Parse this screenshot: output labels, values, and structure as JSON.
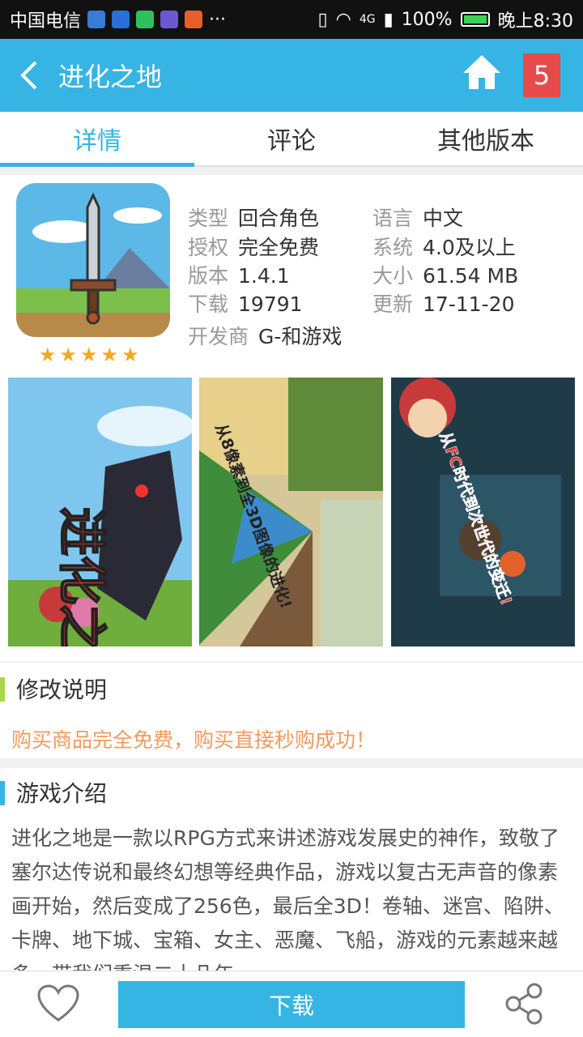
{
  "status_bar": {
    "carrier": "中国电信",
    "network": "4G",
    "battery": "100%",
    "time": "晚上8:30"
  },
  "header": {
    "title": "进化之地",
    "badge_count": "5"
  },
  "tabs": [
    "详情",
    "评论",
    "其他版本"
  ],
  "app_info": {
    "rating_stars": 5,
    "fields": [
      {
        "label": "类型",
        "value": "回合角色"
      },
      {
        "label": "语言",
        "value": "中文"
      },
      {
        "label": "授权",
        "value": "完全免费"
      },
      {
        "label": "系统",
        "value": "4.0及以上"
      },
      {
        "label": "版本",
        "value": "1.4.1"
      },
      {
        "label": "大小",
        "value": "61.54 MB"
      },
      {
        "label": "下载",
        "value": "19791"
      },
      {
        "label": "更新",
        "value": "17-11-20"
      },
      {
        "label": "开发商",
        "value": "G-和游戏"
      }
    ]
  },
  "screenshots": {
    "shot1_title": "进化之地",
    "shot2_caption": "从8像素到全3D图像的进化!",
    "shot3_caption": "从FC时代到次世代的变迁!"
  },
  "modification": {
    "title": "修改说明",
    "text": "购买商品完全免费，购买直接秒购成功！"
  },
  "intro": {
    "title": "游戏介绍",
    "text": "进化之地是一款以RPG方式来讲述游戏发展史的神作，致敬了塞尔达传说和最终幻想等经典作品，游戏以复古无声音的像素画开始，然后变成了256色，最后全3D！卷轴、迷宫、陷阱、卡牌、地下城、宝箱、女主、恶魔、飞船，游戏的元素越来越多，带我们重温二十几年"
  },
  "bottom": {
    "download_label": "下载"
  },
  "colors": {
    "primary": "#36b4e4",
    "badge": "#e74a4a",
    "accent_orange": "#f39a5e",
    "accent_green": "#a6d84a",
    "star": "#f5a623"
  }
}
